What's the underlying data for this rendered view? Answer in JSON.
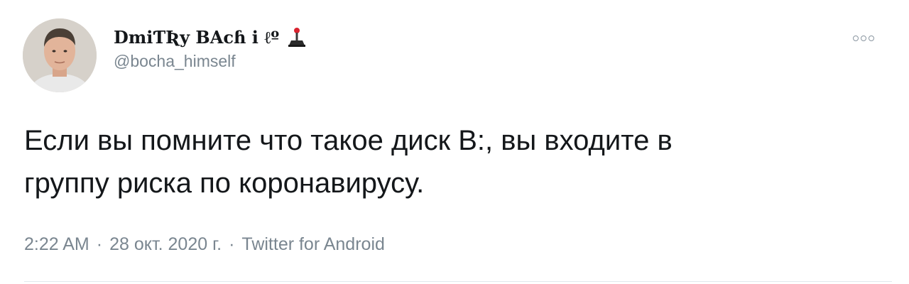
{
  "author": {
    "display_name": "DmiƬƦy BAcɦ i ℓº",
    "handle": "@bocha_himself",
    "avatar": "avatar-photo",
    "name_icon": "joystick-icon"
  },
  "more_button": {
    "icon": "more-options-icon"
  },
  "tweet": {
    "lines": [
      "Если вы помните что такое диск B:, вы входите в",
      "группу риска по коронавирусу."
    ]
  },
  "meta": {
    "time": "2:22 AM",
    "date": "28 окт. 2020 г.",
    "source": "Twitter for Android",
    "separator": "·"
  },
  "colors": {
    "text_primary": "#14171a",
    "text_secondary": "#7a8690",
    "divider": "#e1e8ed"
  }
}
